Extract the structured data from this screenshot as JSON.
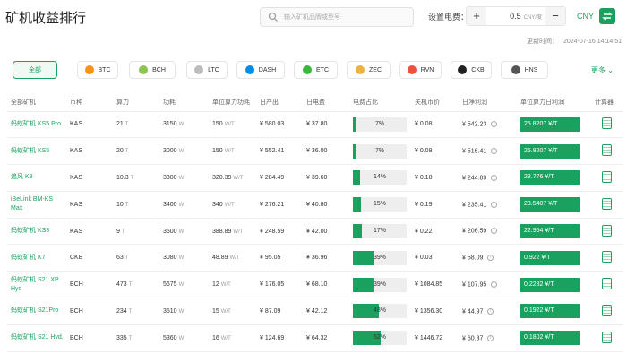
{
  "header": {
    "title": "矿机收益排行",
    "search_placeholder": "输入矿机品牌或型号",
    "elec_label": "设置电费：",
    "elec_value": "0.5",
    "elec_unit": "CNY/度",
    "minus": "−",
    "plus": "+",
    "currency": "CNY",
    "update_label": "更新时间：",
    "update_time": "2024-07-16 14:14:51"
  },
  "filters": [
    {
      "label": "全部",
      "active": true,
      "color": ""
    },
    {
      "label": "BTC",
      "color": "#f7931a"
    },
    {
      "label": "BCH",
      "color": "#8dc351"
    },
    {
      "label": "LTC",
      "color": "#bfbbbb"
    },
    {
      "label": "DASH",
      "color": "#008ce7"
    },
    {
      "label": "ETC",
      "color": "#3ab83a"
    },
    {
      "label": "ZEC",
      "color": "#ecb244"
    },
    {
      "label": "RVN",
      "color": "#f0513f"
    },
    {
      "label": "CKB",
      "color": "#222222"
    },
    {
      "label": "HNS",
      "color": "#555555"
    }
  ],
  "more_label": "更多",
  "table": {
    "headers": [
      "全部矿机",
      "币种",
      "算力",
      "功耗",
      "单位算力功耗",
      "日产出",
      "日电费",
      "电费占比",
      "关机币价",
      "日净利润",
      "单位算力日利润",
      "计算器"
    ],
    "rows": [
      {
        "name": "蚂蚁矿机 KS5 Pro",
        "coin": "KAS",
        "hash": "21",
        "hash_u": "T",
        "power": "3150",
        "power_u": "W",
        "eff": "150",
        "eff_u": "W/T",
        "out": "¥ 580.03",
        "fee": "¥ 37.80",
        "ratio": 7,
        "ratio_label": "7%",
        "shut": "¥ 0.08",
        "net": "¥ 542.23",
        "unit_profit": "25.8207 ¥/T"
      },
      {
        "name": "蚂蚁矿机 KS5",
        "coin": "KAS",
        "hash": "20",
        "hash_u": "T",
        "power": "3000",
        "power_u": "W",
        "eff": "150",
        "eff_u": "W/T",
        "out": "¥ 552.41",
        "fee": "¥ 36.00",
        "ratio": 7,
        "ratio_label": "7%",
        "shut": "¥ 0.08",
        "net": "¥ 516.41",
        "unit_profit": "25.8207 ¥/T"
      },
      {
        "name": "追风 K9",
        "coin": "KAS",
        "hash": "10.3",
        "hash_u": "T",
        "power": "3300",
        "power_u": "W",
        "eff": "320.39",
        "eff_u": "W/T",
        "out": "¥ 284.49",
        "fee": "¥ 39.60",
        "ratio": 14,
        "ratio_label": "14%",
        "shut": "¥ 0.18",
        "net": "¥ 244.89",
        "unit_profit": "23.776 ¥/T"
      },
      {
        "name": "iBeLink BM-KS Max",
        "coin": "KAS",
        "hash": "10",
        "hash_u": "T",
        "power": "3400",
        "power_u": "W",
        "eff": "340",
        "eff_u": "W/T",
        "out": "¥ 276.21",
        "fee": "¥ 40.80",
        "ratio": 15,
        "ratio_label": "15%",
        "shut": "¥ 0.19",
        "net": "¥ 235.41",
        "unit_profit": "23.5407 ¥/T"
      },
      {
        "name": "蚂蚁矿机 KS3",
        "coin": "KAS",
        "hash": "9",
        "hash_u": "T",
        "power": "3500",
        "power_u": "W",
        "eff": "388.89",
        "eff_u": "W/T",
        "out": "¥ 248.59",
        "fee": "¥ 42.00",
        "ratio": 17,
        "ratio_label": "17%",
        "shut": "¥ 0.22",
        "net": "¥ 206.59",
        "unit_profit": "22.954 ¥/T"
      },
      {
        "name": "蚂蚁矿机 K7",
        "coin": "CKB",
        "hash": "63",
        "hash_u": "T",
        "power": "3080",
        "power_u": "W",
        "eff": "48.89",
        "eff_u": "W/T",
        "out": "¥ 95.05",
        "fee": "¥ 36.96",
        "ratio": 39,
        "ratio_label": "39%",
        "shut": "¥ 0.03",
        "net": "¥ 58.09",
        "unit_profit": "0.922 ¥/T"
      },
      {
        "name": "蚂蚁矿机 S21 XP Hyd",
        "coin": "BCH",
        "hash": "473",
        "hash_u": "T",
        "power": "5675",
        "power_u": "W",
        "eff": "12",
        "eff_u": "W/T",
        "out": "¥ 176.05",
        "fee": "¥ 68.10",
        "ratio": 39,
        "ratio_label": "39%",
        "shut": "¥ 1084.85",
        "net": "¥ 107.95",
        "unit_profit": "0.2282 ¥/T"
      },
      {
        "name": "蚂蚁矿机 S21Pro",
        "coin": "BCH",
        "hash": "234",
        "hash_u": "T",
        "power": "3510",
        "power_u": "W",
        "eff": "15",
        "eff_u": "W/T",
        "out": "¥ 87.09",
        "fee": "¥ 42.12",
        "ratio": 48,
        "ratio_label": "48%",
        "shut": "¥ 1356.30",
        "net": "¥ 44.97",
        "unit_profit": "0.1922 ¥/T"
      },
      {
        "name": "蚂蚁矿机 S21 Hyd.",
        "coin": "BCH",
        "hash": "335",
        "hash_u": "T",
        "power": "5360",
        "power_u": "W",
        "eff": "16",
        "eff_u": "W/T",
        "out": "¥ 124.69",
        "fee": "¥ 64.32",
        "ratio": 52,
        "ratio_label": "52%",
        "shut": "¥ 1446.72",
        "net": "¥ 60.37",
        "unit_profit": "0.1802 ¥/T"
      }
    ]
  },
  "colors": {
    "accent": "#1aa15f"
  }
}
